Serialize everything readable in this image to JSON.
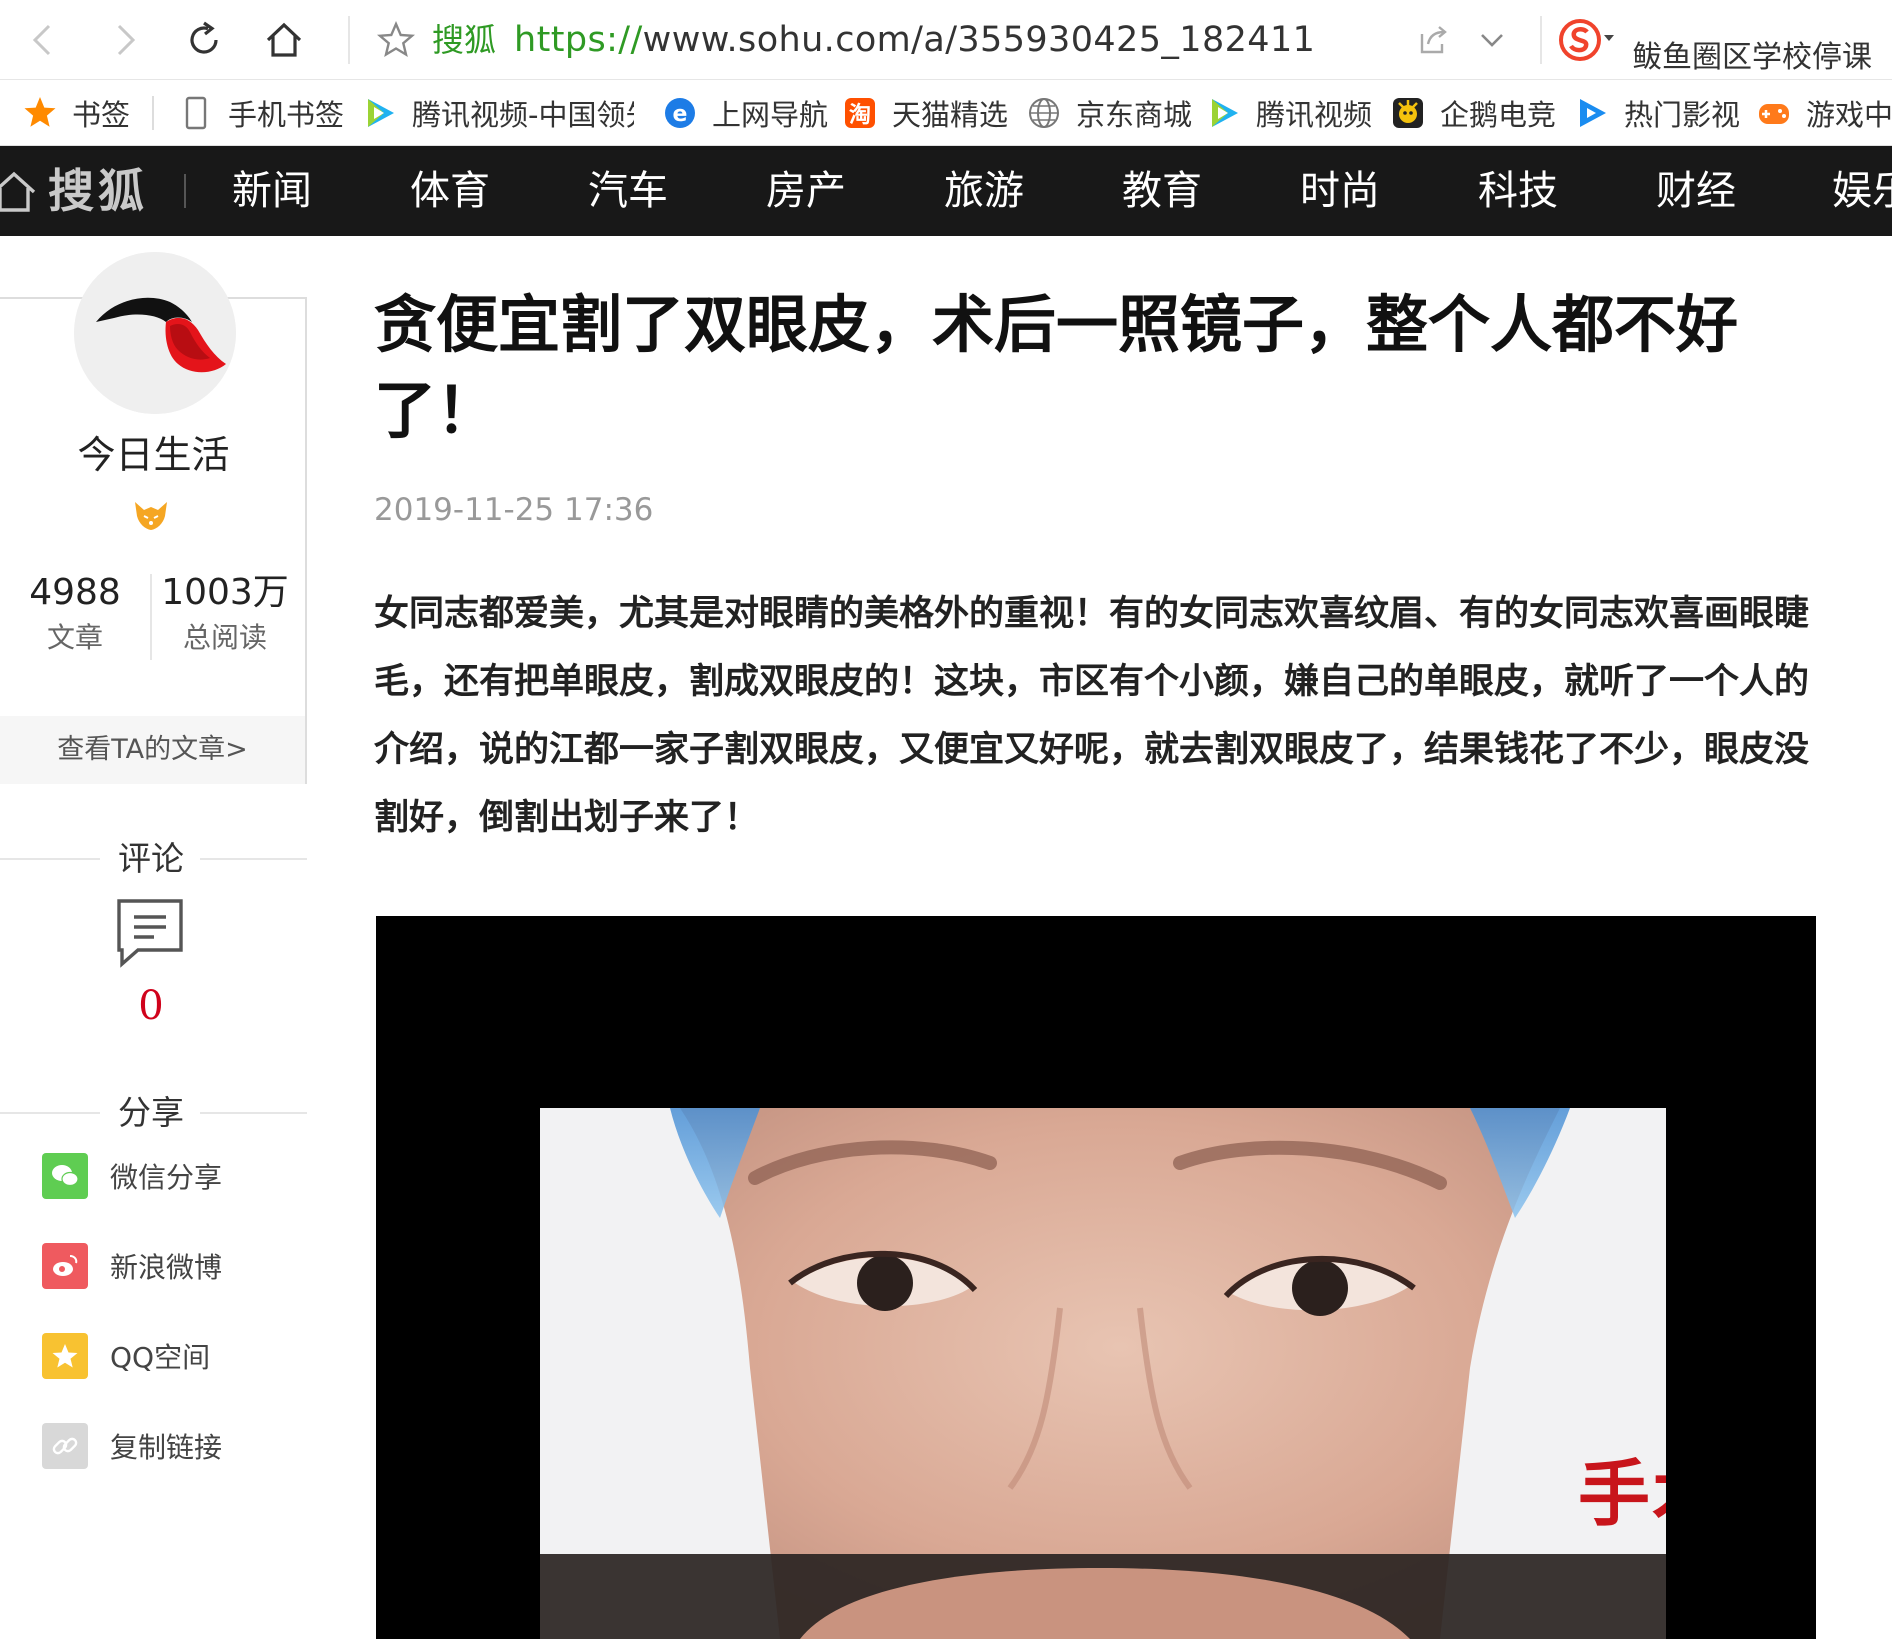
{
  "browser": {
    "site_label": "搜狐",
    "url_scheme": "https://",
    "url_rest": "www.sohu.com/a/355930425_182411",
    "search_hint": "鲅鱼圈区学校停课"
  },
  "bookmarks": [
    {
      "label": "书签",
      "icon": "star-icon"
    },
    {
      "label": "手机书签",
      "icon": "phone-icon"
    },
    {
      "label": "腾讯视频-中国领先",
      "icon": "tencent-video-icon"
    },
    {
      "label": "上网导航",
      "icon": "ie-icon"
    },
    {
      "label": "天猫精选",
      "icon": "taobao-icon"
    },
    {
      "label": "京东商城",
      "icon": "globe-icon"
    },
    {
      "label": "腾讯视频",
      "icon": "tencent-video-icon"
    },
    {
      "label": "企鹅电竞",
      "icon": "penguin-esports-icon"
    },
    {
      "label": "热门影视",
      "icon": "play-icon"
    },
    {
      "label": "游戏中心",
      "icon": "gamepad-icon"
    }
  ],
  "sitenav": {
    "logo": "搜狐",
    "items": [
      "新闻",
      "体育",
      "汽车",
      "房产",
      "旅游",
      "教育",
      "时尚",
      "科技",
      "财经",
      "娱乐"
    ]
  },
  "author": {
    "name": "今日生活",
    "articles_count": "4988",
    "articles_label": "文章",
    "reads_count": "1003万",
    "reads_label": "总阅读",
    "view_link": "查看TA的文章>"
  },
  "comments": {
    "heading": "评论",
    "count": "0"
  },
  "share": {
    "heading": "分享",
    "items": [
      {
        "label": "微信分享",
        "color": "#5fcd52",
        "icon": "wechat-icon"
      },
      {
        "label": "新浪微博",
        "color": "#ef5a5f",
        "icon": "weibo-icon"
      },
      {
        "label": "QQ空间",
        "color": "#f8c231",
        "icon": "qzone-icon"
      },
      {
        "label": "复制链接",
        "color": "#d8d8d8",
        "icon": "link-icon"
      }
    ]
  },
  "article": {
    "title": "贪便宜割了双眼皮，术后一照镜子，整个人都不好了！",
    "time": "2019-11-25 17:36",
    "body": "女同志都爱美，尤其是对眼睛的美格外的重视！有的女同志欢喜纹眉、有的女同志欢喜画眼睫毛，还有把单眼皮，割成双眼皮的！这块，市区有个小颜，嫌自己的单眼皮，就听了一个人的介绍，说的江都一家子割双眼皮，又便宜又好呢，就去割双眼皮了，结果钱花了不少，眼皮没割好，倒割出划子来了！",
    "image_caption": "手术前"
  },
  "colors": {
    "nav_bg": "#181818",
    "url_green": "#2f9a24",
    "comment_red": "#d0021b"
  }
}
